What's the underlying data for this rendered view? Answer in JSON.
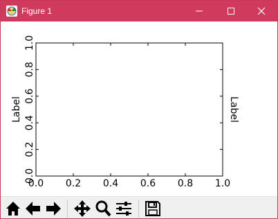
{
  "window": {
    "title": "Figure 1"
  },
  "icons": {
    "app": "matplotlib-figure-icon",
    "minimize": "minimize-icon",
    "maximize": "maximize-icon",
    "close": "close-icon"
  },
  "colors": {
    "titlebar": "#d03a5c",
    "toolbar": "#f0f0f0"
  },
  "plot": {
    "xticks": [
      "0.0",
      "0.2",
      "0.4",
      "0.6",
      "0.8",
      "1.0"
    ],
    "yticks": [
      "0.0",
      "0.2",
      "0.4",
      "0.6",
      "0.8",
      "1.0"
    ],
    "ylabel_left": "Label",
    "ylabel_right": "Label"
  },
  "toolbar": {
    "buttons": [
      "home-icon",
      "back-icon",
      "forward-icon",
      "pan-icon",
      "zoom-icon",
      "configure-subplots-icon",
      "save-icon"
    ]
  }
}
